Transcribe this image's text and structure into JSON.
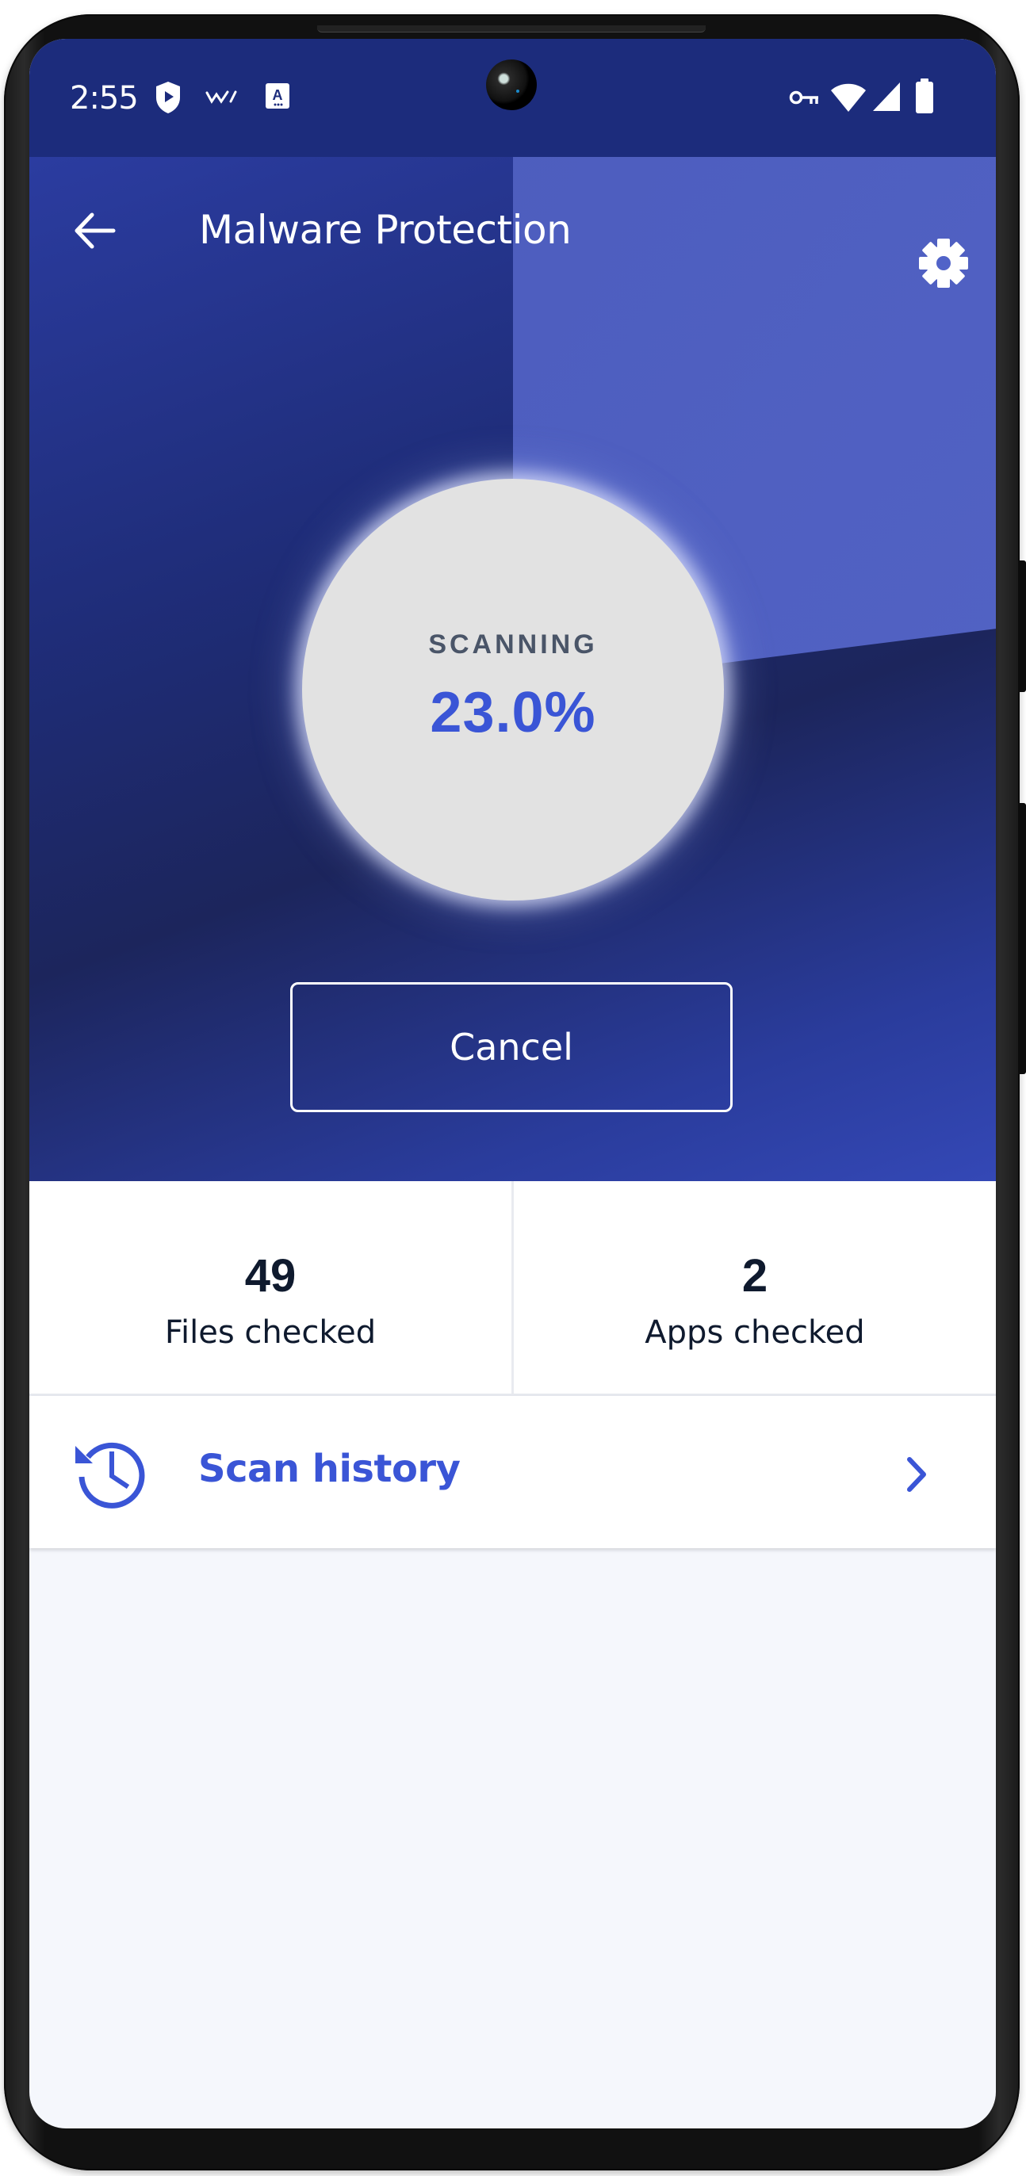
{
  "status_bar": {
    "time": "2:55",
    "left_icons": [
      "play-protect-shield-icon",
      "wave-notification-icon",
      "accessibility-a-icon"
    ],
    "right_icons": [
      "vpn-key-icon",
      "wifi-icon",
      "cell-signal-icon",
      "battery-icon"
    ]
  },
  "app_bar": {
    "title": "Malware Protection",
    "back_icon": "arrow-left-icon",
    "settings_icon": "gear-icon"
  },
  "scan": {
    "status_label": "SCANNING",
    "progress_text": "23.0%",
    "progress_fraction": 0.23,
    "cancel_label": "Cancel"
  },
  "stats": [
    {
      "value": "49",
      "label": "Files checked"
    },
    {
      "value": "2",
      "label": "Apps checked"
    }
  ],
  "history": {
    "label": "Scan history",
    "icon": "history-clock-icon",
    "chevron": "chevron-right-icon"
  },
  "colors": {
    "status_bar": "#1c2c7c",
    "accent": "#3a55d6",
    "progress_wedge": "#5468d0",
    "text_dark": "#0f1a2e",
    "label_gray": "#4a5568",
    "page_bg": "#f5f7fc"
  }
}
